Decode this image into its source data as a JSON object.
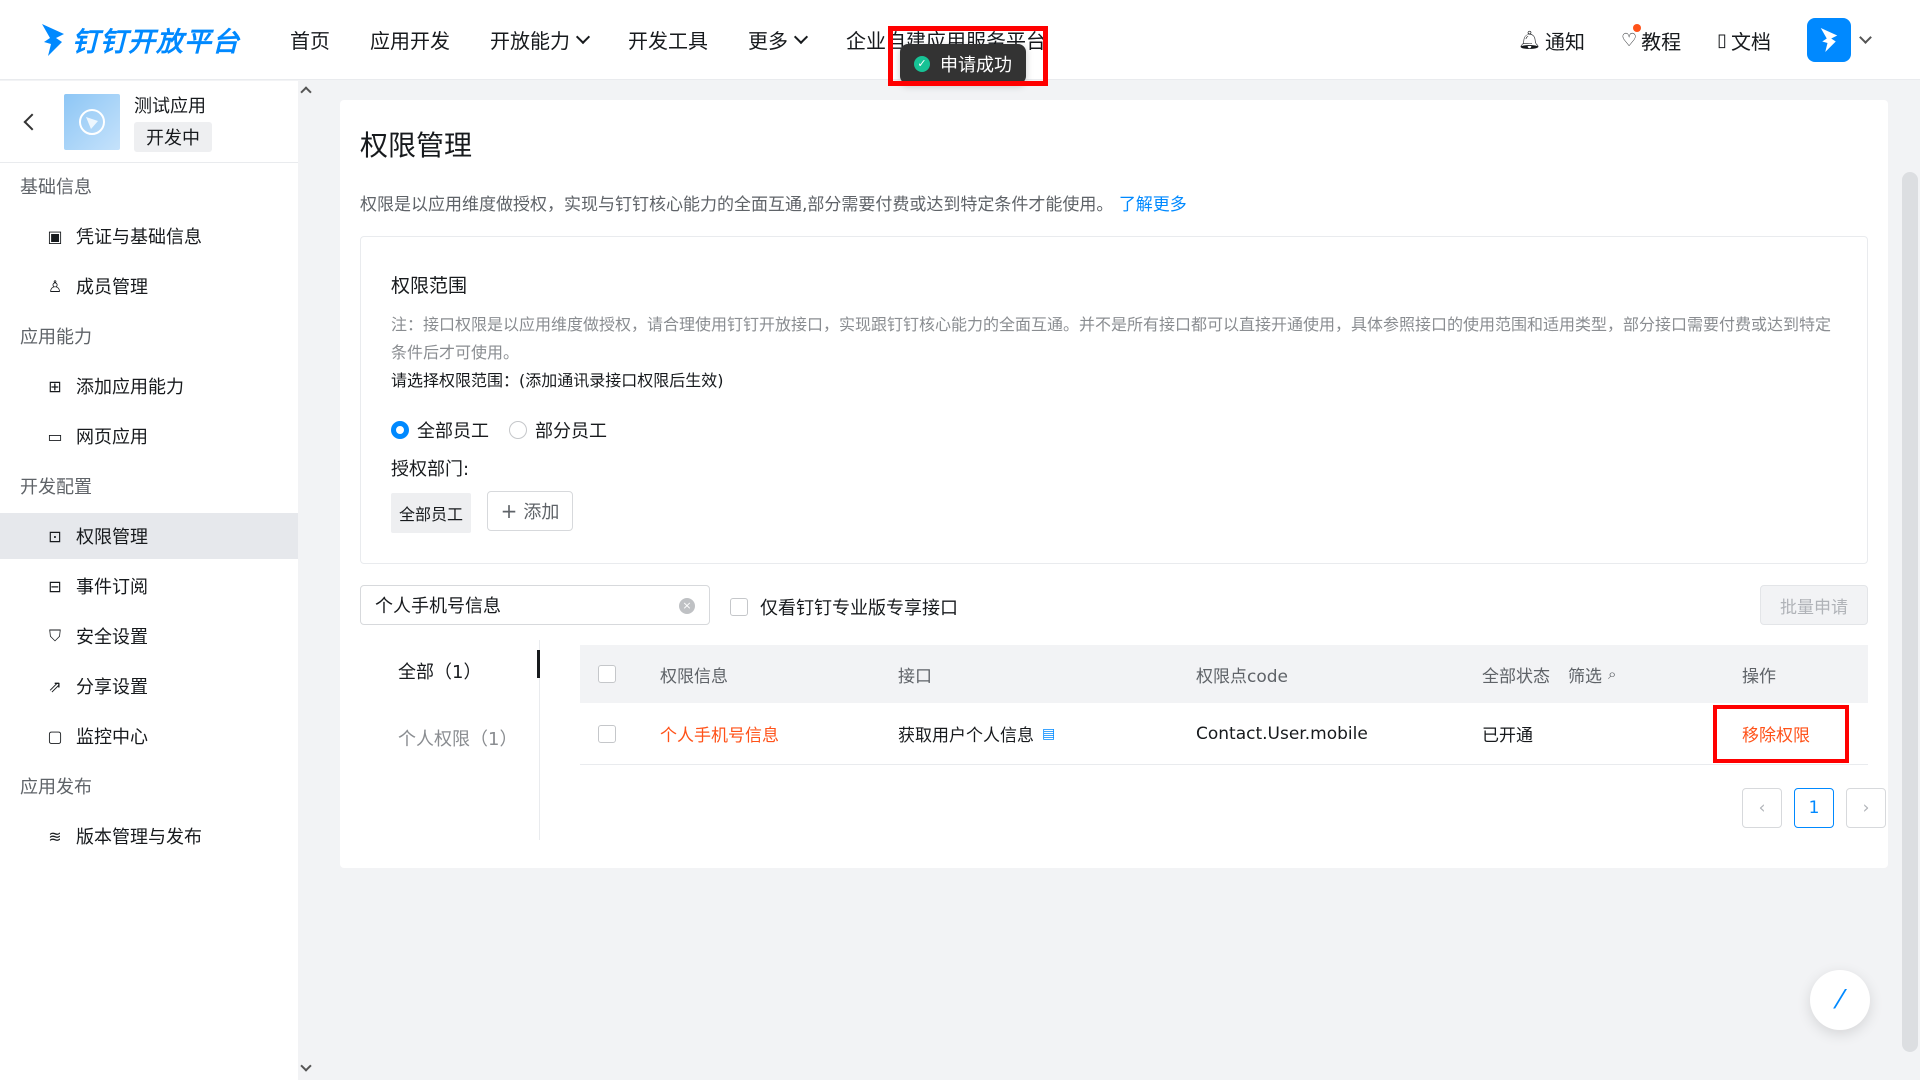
{
  "header": {
    "logo_text": "钉钉开放平台",
    "nav": [
      {
        "label": "首页"
      },
      {
        "label": "应用开发"
      },
      {
        "label": "开放能力"
      },
      {
        "label": "开发工具"
      },
      {
        "label": "更多"
      },
      {
        "label": "企业自建应用服务平台"
      }
    ],
    "notify": "通知",
    "tutorial": "教程",
    "docs": "文档"
  },
  "toast": {
    "text": "申请成功"
  },
  "sidebar": {
    "app_name": "测试应用",
    "app_status": "开发中",
    "sections": [
      {
        "title": "基础信息",
        "items": [
          {
            "label": "凭证与基础信息",
            "icon": "credential-icon"
          },
          {
            "label": "成员管理",
            "icon": "user-icon"
          }
        ]
      },
      {
        "title": "应用能力",
        "items": [
          {
            "label": "添加应用能力",
            "icon": "apps-icon"
          },
          {
            "label": "网页应用",
            "icon": "webpage-icon"
          }
        ]
      },
      {
        "title": "开发配置",
        "items": [
          {
            "label": "权限管理",
            "icon": "lock-icon"
          },
          {
            "label": "事件订阅",
            "icon": "rss-icon"
          },
          {
            "label": "安全设置",
            "icon": "shield-icon"
          },
          {
            "label": "分享设置",
            "icon": "share-icon"
          },
          {
            "label": "监控中心",
            "icon": "monitor-icon"
          }
        ]
      },
      {
        "title": "应用发布",
        "items": [
          {
            "label": "版本管理与发布",
            "icon": "layers-icon"
          }
        ]
      }
    ]
  },
  "main": {
    "title": "权限管理",
    "desc": "权限是以应用维度做授权，实现与钉钉核心能力的全面互通,部分需要付费或达到特定条件才能使用。",
    "learn_more": "了解更多",
    "scope": {
      "title": "权限范围",
      "note": "注：接口权限是以应用维度做授权，请合理使用钉钉开放接口，实现跟钉钉核心能力的全面互通。并不是所有接口都可以直接开通使用，具体参照接口的使用范围和适用类型，部分接口需要付费或达到特定条件后才可使用。",
      "choose": "请选择权限范围：(添加通讯录接口权限后生效)",
      "radio_all": "全部员工",
      "radio_part": "部分员工",
      "dept_label": "授权部门:",
      "dept_tag": "全部员工",
      "add_label": "添加"
    },
    "search_value": "个人手机号信息",
    "only_pro": "仅看钉钉专业版专享接口",
    "batch_apply": "批量申请",
    "categories": [
      "全部（1）",
      "个人权限（1）"
    ],
    "table": {
      "headers": {
        "info": "权限信息",
        "api": "接口",
        "code": "权限点code",
        "status": "全部状态",
        "filter": "筛选",
        "op": "操作"
      },
      "rows": [
        {
          "info": "个人手机号信息",
          "api": "获取用户个人信息",
          "code": "Contact.User.mobile",
          "status": "已开通",
          "op": "移除权限"
        }
      ]
    },
    "pagination": {
      "current": "1"
    }
  }
}
